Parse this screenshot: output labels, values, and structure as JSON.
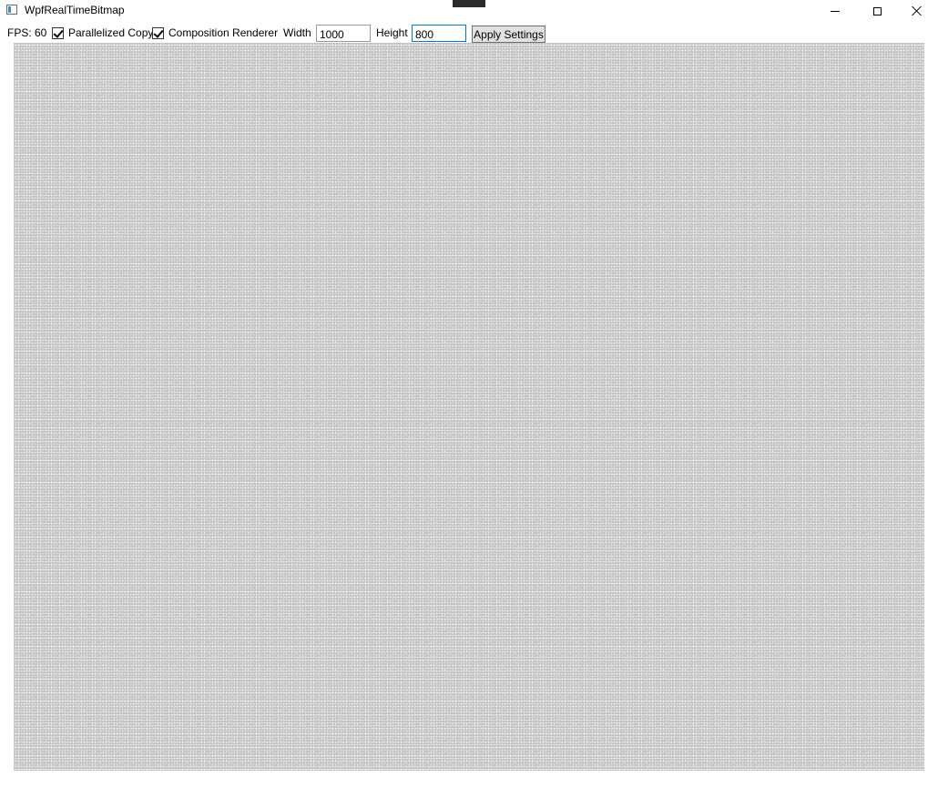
{
  "window": {
    "title": "WpfRealTimeBitmap"
  },
  "toolbar": {
    "fps_label": "FPS: 60",
    "parallelized_copy": {
      "label": "Parallelized Copy",
      "checked": true
    },
    "composition_renderer": {
      "label": "Composition Renderer",
      "checked": true
    },
    "width_label": "Width",
    "width_value": "1000",
    "height_label": "Height",
    "height_value": "800",
    "apply_label": "Apply Settings"
  },
  "colors": {
    "bitmap_noise_base": "#d4d4d4",
    "focus_border": "#0078d7",
    "button_face": "#e1e1e1"
  },
  "icons": {
    "app": "window-app-icon",
    "minimize": "minimize-icon",
    "maximize": "maximize-icon",
    "close": "close-icon"
  }
}
